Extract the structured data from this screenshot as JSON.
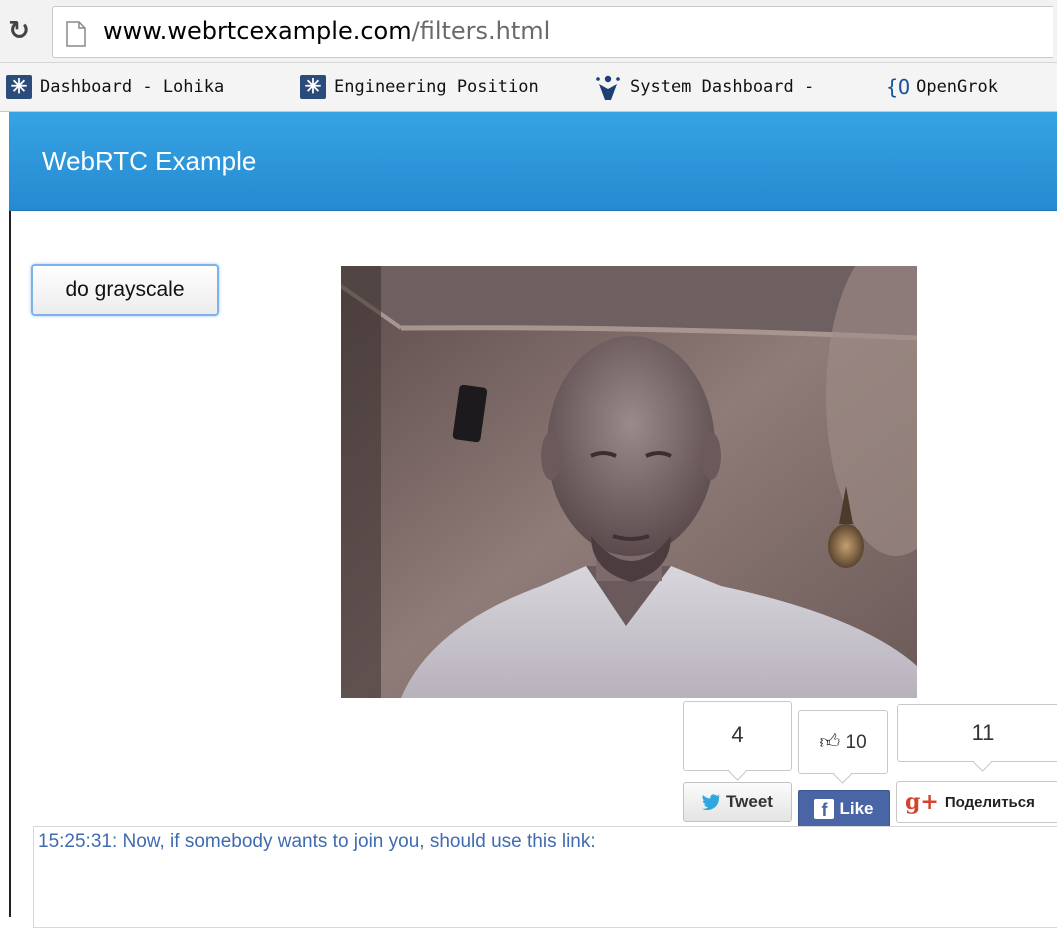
{
  "browser": {
    "url_host": "www.webrtcexample.com",
    "url_path": "/filters.html",
    "bookmarks": [
      {
        "label": "Dashboard - Lohika",
        "icon": "jira-icon"
      },
      {
        "label": "Engineering Position",
        "icon": "jira-icon"
      },
      {
        "label": "System Dashboard -",
        "icon": "confluence-icon"
      },
      {
        "label": "OpenGrok",
        "icon": "opengrok-icon"
      }
    ]
  },
  "app": {
    "title": "WebRTC Example",
    "header_color": "#2f98dd"
  },
  "controls": {
    "grayscale_button": "do grayscale"
  },
  "social": {
    "tweet_count": "4",
    "tweet_label": "Tweet",
    "fb_count": "10",
    "fb_label": "Like",
    "gplus_count": "11",
    "gplus_label": "Поделиться"
  },
  "log": {
    "line": "15:25:31: Now, if somebody wants to join you, should use this link:"
  }
}
